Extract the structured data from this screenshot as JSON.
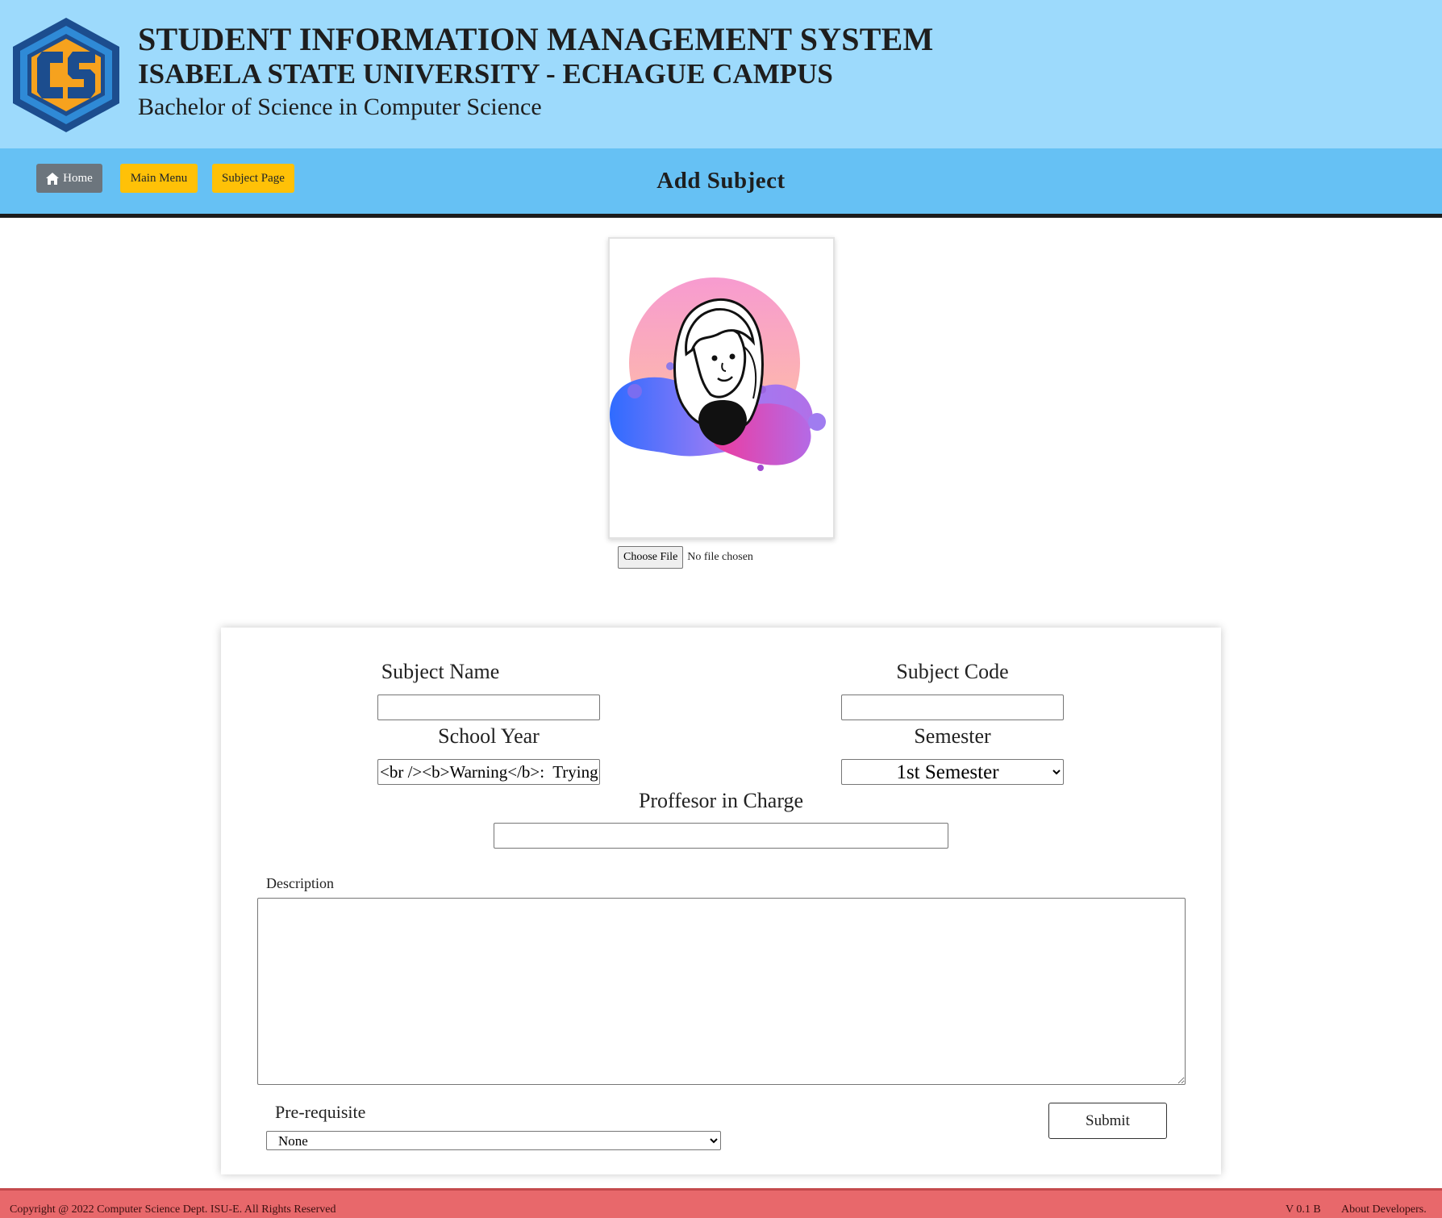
{
  "header": {
    "title": "STUDENT INFORMATION MANAGEMENT SYSTEM",
    "university": "ISABELA STATE UNIVERSITY - ECHAGUE CAMPUS",
    "course": "Bachelor of Science in Computer Science",
    "logo_icon": "cs-hexagon-logo-icon",
    "colors": {
      "header_bg": "#9ddafc",
      "nav_bg": "#66c1f4"
    }
  },
  "nav": {
    "home_label": "Home",
    "main_menu_label": "Main Menu",
    "subject_page_label": "Subject Page",
    "page_heading": "Add Subject",
    "colors": {
      "home_btn": "#6c757d",
      "warning_btn": "#ffc107"
    }
  },
  "image_upload": {
    "choose_label": "Choose File",
    "status": "No file chosen",
    "avatar_icon": "avatar-illustration-icon"
  },
  "form": {
    "subject_name": {
      "label": "Subject Name",
      "value": ""
    },
    "subject_code": {
      "label": "Subject Code",
      "value": ""
    },
    "school_year": {
      "label": "School Year",
      "value": "<br /><b>Warning</b>:  Trying to access array offset on value of type null"
    },
    "semester": {
      "label": "Semester",
      "selected": "1st Semester"
    },
    "professor": {
      "label": "Proffesor in Charge",
      "value": ""
    },
    "description": {
      "label": "Description",
      "value": ""
    },
    "prerequisite": {
      "label": "Pre-requisite",
      "selected": "None"
    },
    "submit_label": "Submit"
  },
  "footer": {
    "copyright": "Copyright @ 2022 Computer Science Dept. ISU-E. All Rights Reserved",
    "version": "V 0.1 B",
    "about_label": "About Developers.",
    "color": "#e8686b"
  }
}
